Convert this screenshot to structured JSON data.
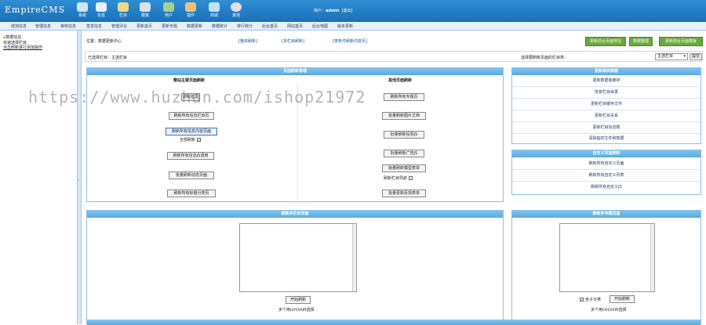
{
  "logo": {
    "brand": "EmpireCMS"
  },
  "top_icons": [
    {
      "label": "系统",
      "icon": "system-icon",
      "color": "#cfe4f7"
    },
    {
      "label": "信息",
      "icon": "info-icon",
      "color": "#e8eef6"
    },
    {
      "label": "栏目",
      "icon": "column-icon",
      "color": "#f0d98a"
    },
    {
      "label": "模板",
      "icon": "template-icon",
      "color": "#d6e2ef"
    },
    {
      "label": "用户",
      "icon": "user-icon",
      "color": "#a8d18a"
    },
    {
      "label": "插件",
      "icon": "plugin-icon",
      "color": "#f3c07a"
    },
    {
      "label": "商城",
      "icon": "shop-icon",
      "color": "#bfe3f5"
    },
    {
      "label": "其他",
      "icon": "other-icon",
      "color": "#e0e0e0"
    }
  ],
  "userbar": {
    "prefix": "用户：",
    "user": "admin",
    "logout": "[退出]"
  },
  "menu": [
    "增加信息",
    "管理信息",
    "审核信息",
    "签发信息",
    "管理评论",
    "更新首页",
    "更新专题",
    "数据更新",
    "数据统计",
    "排行统计",
    "后台首页",
    "网站首页",
    "后台地图",
    "版本更新"
  ],
  "left_nav": [
    "数据信息",
    "快速选择栏目",
    "点击刷新进行添加操作"
  ],
  "split_arrow": "‹",
  "crumb": "位置：数据更新中心",
  "links": [
    "[整体刷新]",
    "[多栏目刷新]",
    "[按条件刷新内容页]"
  ],
  "green_buttons": [
    "更新前台页面地址",
    "数据整理",
    "更新前台页面模板"
  ],
  "bar2": {
    "text": "已选择栏目：主选栏目",
    "select_label": "选择要刷新页面的栏目类：",
    "select_value": "主选栏目",
    "submit": "提交"
  },
  "panel_main": {
    "title": "页面刷新管理",
    "left_head": "整站主要页面刷新",
    "right_head": "其他页面刷新",
    "left_buttons": [
      "刷新首页",
      "刷新所有信息栏目页",
      "刷新所有信息内容页面",
      "刷新所有信息JS调用",
      "批量刷新动态页面",
      "刷新所有标题分类页"
    ],
    "all_refresh": "全部刷新",
    "right_buttons": [
      "刷新所有专题页",
      "批量刷新图片文档",
      "批量刷新投票JS",
      "批量刷新广告JS",
      "批量刷新模型表单",
      "批量更新反馈表单"
    ],
    "column_nav": "刷新栏目导航"
  },
  "panel_data": {
    "title": "更新相关数据",
    "rows": [
      "更新数据库缓存",
      "恢复栏目目录",
      "更新栏目缓存文件",
      "更新栏目关系",
      "更新栏目信息数",
      "清除临时文件和数据"
    ]
  },
  "panel_custom": {
    "title": "自定义页面刷新",
    "rows": [
      "刷新所有自定义页面",
      "刷新所有自定义列表",
      "刷新所有自定义JS"
    ]
  },
  "panel_multi": {
    "title": "刷新多栏目页面",
    "button": "开始刷新",
    "hint": "多个用ctrl/shift选择"
  },
  "panel_multi2": {
    "title": "刷新多专题页面",
    "include_sub": "含子分类",
    "button": "开始刷新",
    "hint": "多个用ctrl/shift选择"
  },
  "watermark": "https://www.huzhan.com/ishop21972"
}
